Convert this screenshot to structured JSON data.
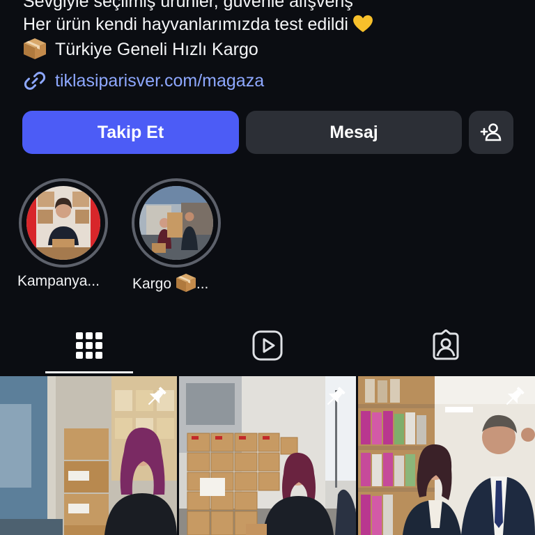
{
  "profile": {
    "bio_lines": [
      "Sevgiyle seçilmiş ürünler, güvenle alışveriş",
      "Her ürün kendi hayvanlarımızda test edildi",
      "Türkiye Geneli Hızlı Kargo"
    ],
    "link": "tiklasiparisver.com/magaza"
  },
  "actions": {
    "follow_label": "Takip Et",
    "message_label": "Mesaj",
    "add_friend_icon": "person-add-icon"
  },
  "highlights": [
    {
      "label": "Kampanya..."
    },
    {
      "label": "Kargo"
    }
  ],
  "tabs": [
    {
      "icon": "grid-icon",
      "selected": true
    },
    {
      "icon": "reels-icon",
      "selected": false
    },
    {
      "icon": "tagged-icon",
      "selected": false
    }
  ],
  "posts": [
    {
      "pinned": true
    },
    {
      "pinned": true
    },
    {
      "pinned": true
    }
  ],
  "colors": {
    "background": "#0b0d12",
    "follow_button": "#4c5cf6",
    "secondary_button": "#2c2f36",
    "link": "#8ea8ff",
    "highlight_ring": "#5d616b"
  }
}
